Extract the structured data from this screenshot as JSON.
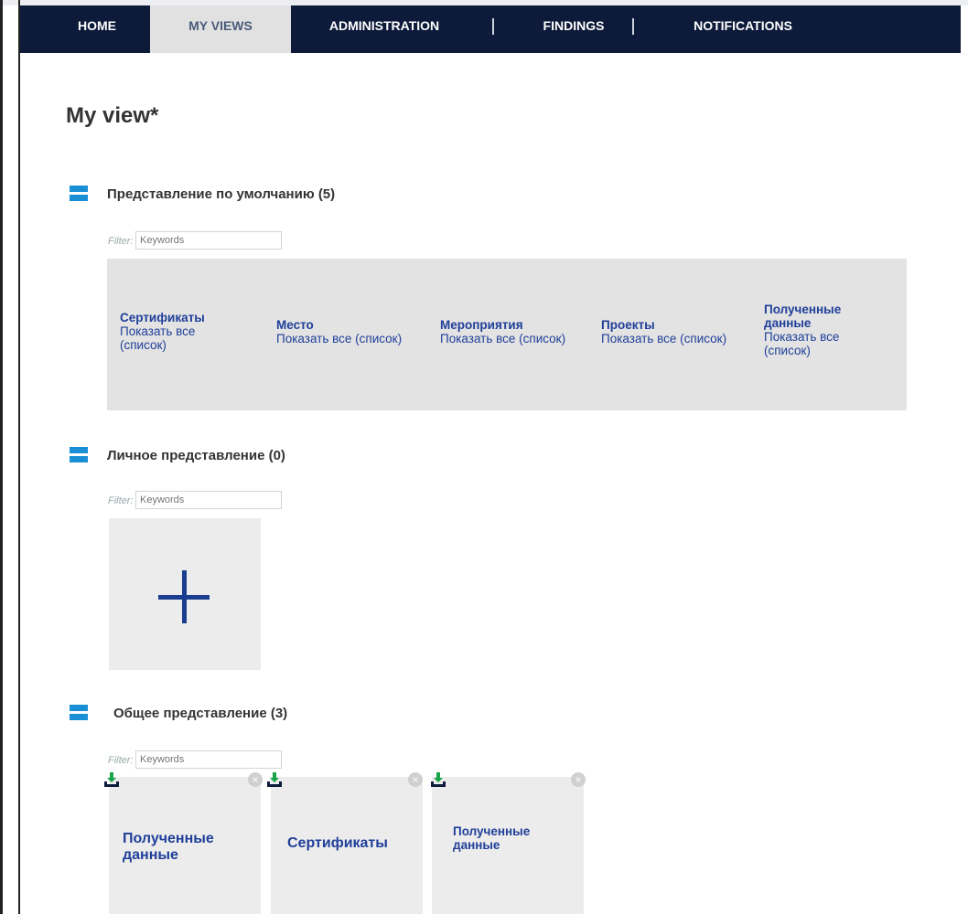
{
  "nav": {
    "home": "HOME",
    "my_views": "MY VIEWS",
    "administration": "ADMINISTRATION",
    "findings": "FINDINGS",
    "notifications": "NOTIFICATIONS"
  },
  "page": {
    "title": "My view*"
  },
  "filter": {
    "label": "Filter:",
    "placeholder": "Keywords"
  },
  "default_view": {
    "title": "Представление по умолчанию (5)",
    "columns": [
      {
        "title": "Сертификаты",
        "link": "Показать все (список)"
      },
      {
        "title": "Место",
        "link": "Показать все (список)"
      },
      {
        "title": "Мероприятия",
        "link": "Показать все (список)"
      },
      {
        "title": "Проекты",
        "link": "Показать все (список)"
      },
      {
        "title": "Полученные данные",
        "link": "Показать все (список)"
      }
    ]
  },
  "personal_view": {
    "title": "Личное представление (0)"
  },
  "shared_view": {
    "title": "Общее представление (3)",
    "tiles": [
      {
        "title": "Полученные данные"
      },
      {
        "title": "Сертификаты"
      },
      {
        "title": "Полученные данные"
      }
    ]
  },
  "icons": {
    "section": "collapse-icon",
    "add": "plus-icon",
    "download": "download-icon",
    "close": "close-icon"
  },
  "colors": {
    "nav_bg": "#0d1a3a",
    "accent": "#1b8fd6",
    "link": "#1f3f99",
    "panel_bg": "#e3e3e3"
  }
}
